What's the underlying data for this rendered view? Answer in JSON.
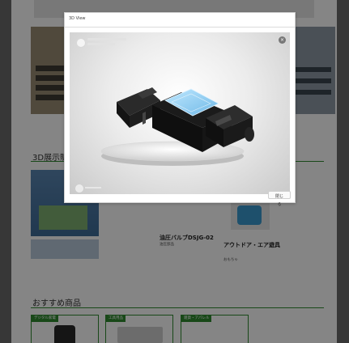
{
  "modal": {
    "title": "3D View",
    "close_label": "閉じる"
  },
  "sections": {
    "showroom_heading": "3D展示販",
    "recommended_heading": "おすすめ商品"
  },
  "products": [
    {
      "name": "油圧バルブDSJG-02",
      "category": "油圧部品"
    },
    {
      "name": "アウトドア・エア遊具",
      "category": "おもちゃ"
    }
  ],
  "recommended": [
    {
      "badge": "デジタル家電"
    },
    {
      "badge": "工具用品"
    },
    {
      "badge": "雑貨・アパレル"
    }
  ],
  "colors": {
    "accent": "#2e8b2e",
    "overlay": "rgba(0,0,0,0.48)"
  }
}
